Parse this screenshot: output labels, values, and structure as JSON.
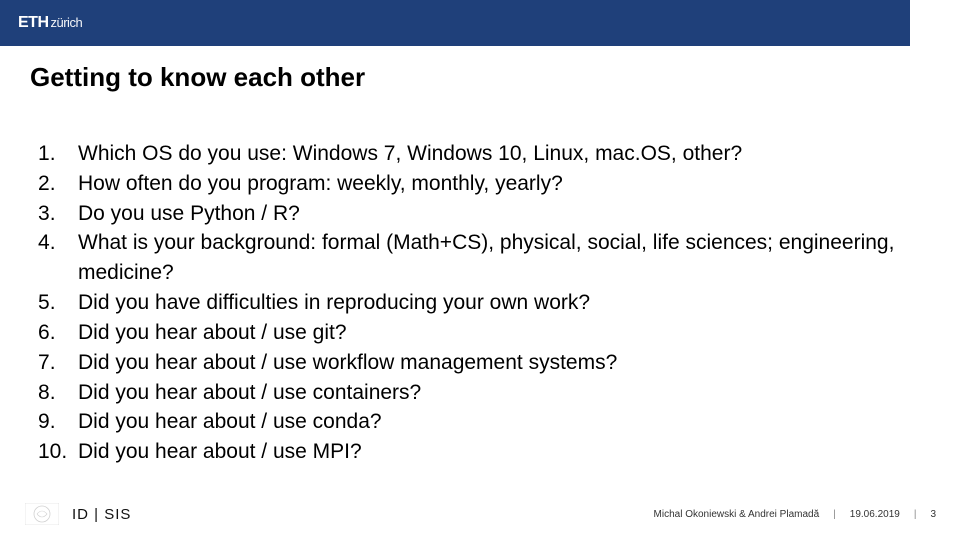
{
  "header": {
    "logo_main": "ETH",
    "logo_sub": "zürich"
  },
  "title": "Getting to know each other",
  "questions": [
    "Which OS do you use: Windows 7, Windows 10, Linux, mac.OS, other?",
    "How often do you program: weekly, monthly, yearly?",
    "Do you use Python / R?",
    "What is your background: formal (Math+CS), physical, social, life sciences; engineering, medicine?",
    "Did you have difficulties in reproducing your own work?",
    "Did you hear about / use git?",
    "Did you hear about / use workflow management systems?",
    "Did you hear about / use containers?",
    "Did you hear about / use conda?",
    "Did you hear about / use MPI?"
  ],
  "footer": {
    "department": "ID | SIS",
    "authors": "Michal Okoniewski & Andrei Plamadă",
    "date": "19.06.2019",
    "page": "3",
    "separator": "|"
  }
}
